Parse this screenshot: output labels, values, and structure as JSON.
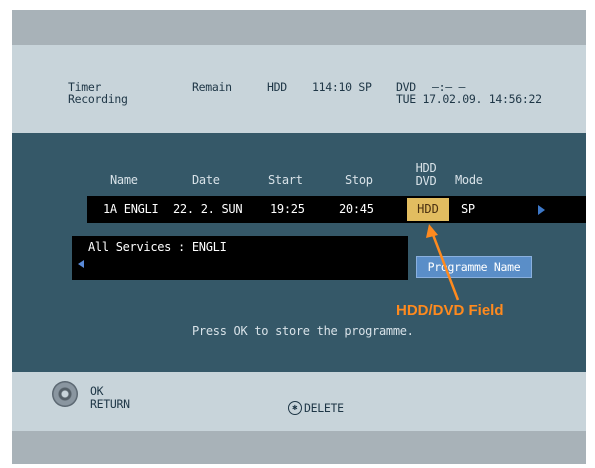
{
  "header": {
    "timer_line1": "Timer",
    "timer_line2": "Recording",
    "remain_label": "Remain",
    "drive_label": "HDD",
    "remain_value": "114:10 SP",
    "dvd_label": "DVD",
    "dvd_status": "—:— —",
    "datetime": "TUE 17.02.09. 14:56:22"
  },
  "table": {
    "headers": {
      "name": "Name",
      "date": "Date",
      "start": "Start",
      "stop": "Stop",
      "hdd_dvd_line1": "HDD",
      "hdd_dvd_line2": "DVD",
      "mode": "Mode"
    },
    "row": {
      "name": "1A ENGLI",
      "date": "22. 2. SUN",
      "start": "19:25",
      "stop": "20:45",
      "hdd_dvd": "HDD",
      "mode": "SP"
    }
  },
  "services": {
    "text": "All Services : ENGLI"
  },
  "programme_button": "Programme Name",
  "annotation": "HDD/DVD Field",
  "message": "Press OK to store the programme.",
  "footer": {
    "ok_label": "OK",
    "return_label": "RETURN",
    "delete_icon": "✱",
    "delete_label": "DELETE"
  },
  "colors": {
    "screen_background": "#355868",
    "header_background": "#c8d4da",
    "selected_cell": "#e2bd60",
    "annotation": "#ff8a1e",
    "button_blue": "#5a8ec8"
  },
  "icons": [
    "disc-icon",
    "arrow-right-icon",
    "arrow-left-icon",
    "asterisk-delete-icon",
    "callout-arrow"
  ]
}
